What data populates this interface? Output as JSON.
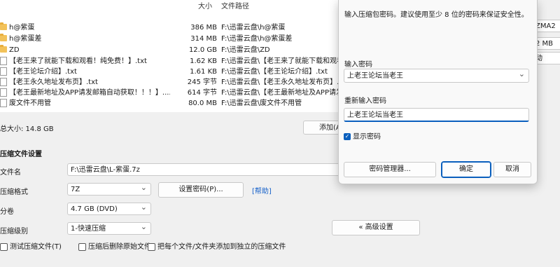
{
  "file_list": {
    "columns": {
      "size": "大小",
      "path": "文件路径"
    },
    "rows": [
      {
        "type": "folder",
        "name": "h@紫蛋",
        "size": "386 MB",
        "path": "F:\\迅雷云盘\\h@紫蛋"
      },
      {
        "type": "folder",
        "name": "h@紫蛋差",
        "size": "314 MB",
        "path": "F:\\迅雷云盘\\h@紫蛋差"
      },
      {
        "type": "folder",
        "name": "ZD",
        "size": "12.0 GB",
        "path": "F:\\迅雷云盘\\ZD"
      },
      {
        "type": "txt",
        "name": "【老王来了就能下载和观看！纯免费！】.txt",
        "size": "1.62 KB",
        "path": "F:\\迅雷云盘\\【老王来了就能下载和观看"
      },
      {
        "type": "txt",
        "name": "【老王论坛介绍】.txt",
        "size": "1.61 KB",
        "path": "F:\\迅雷云盘\\【老王论坛介绍】.txt"
      },
      {
        "type": "txt",
        "name": "【老王永久地址发布页】.txt",
        "size": "245 字节",
        "path": "F:\\迅雷云盘\\【老王永久地址发布页】.tx"
      },
      {
        "type": "txt",
        "name": "【老王最新地址及APP请发邮箱自动获取！！！】....",
        "size": "614 字节",
        "path": "F:\\迅雷云盘\\【老王最新地址及APP请发"
      },
      {
        "type": "txt",
        "name": "废文件不用管",
        "size": "80.0 MB",
        "path": "F:\\迅雷云盘\\废文件不用管"
      }
    ]
  },
  "total_size": "总大小: 14.8 GB",
  "add_button": "添加(A",
  "settings": {
    "section_title": "压缩文件设置",
    "filename_label": "文件名",
    "filename_value": "F:\\迅雷云盘\\L-紫蛋.7z",
    "format_label": "压缩格式",
    "format_value": "7Z",
    "set_password_button": "设置密码(P)...",
    "help_link": "[帮助]",
    "volume_label": "分卷",
    "volume_value": "4.7 GB (DVD)",
    "level_label": "压缩级别",
    "level_value": "1-快速压缩",
    "advanced_button": "« 高级设置",
    "checkbox_test": "测试压缩文件(T)",
    "checkbox_delete": "压缩后删除原始文件",
    "checkbox_separate": "把每个文件/文件夹添加到独立的压缩文件"
  },
  "right_panel": {
    "method": "ZMA2",
    "dict": "2 MB",
    "auto": "动"
  },
  "dialog": {
    "hint": "输入压缩包密码。建议使用至少 8 位的密码来保证安全性。",
    "password_label": "输入密码",
    "password_value": "上老王论坛当老王",
    "reenter_label": "重新输入密码",
    "reenter_value": "上老王论坛当老王",
    "show_password": "显示密码",
    "manager_button": "密码管理器...",
    "ok_button": "确定",
    "cancel_button": "取消"
  },
  "colors": {
    "accent": "#0a5fbd",
    "folder": "#f2c25a",
    "link": "#1560c9"
  }
}
